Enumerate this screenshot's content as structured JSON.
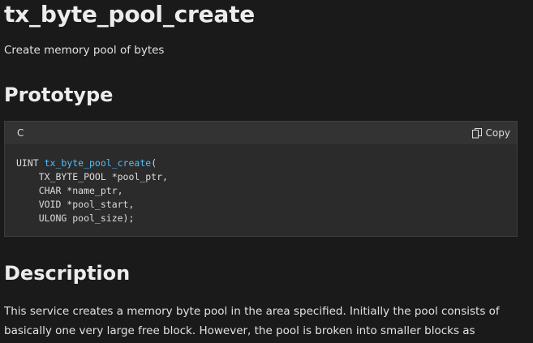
{
  "page": {
    "title": "tx_byte_pool_create",
    "subtitle": "Create memory pool of bytes"
  },
  "prototype": {
    "heading": "Prototype",
    "language": "C",
    "copy_label": "Copy",
    "copy_icon": "copy-icon",
    "code": {
      "return_type": "UINT ",
      "function_name": "tx_byte_pool_create",
      "open_paren": "(",
      "params": [
        "    TX_BYTE_POOL *pool_ptr,",
        "    CHAR *name_ptr,",
        "    VOID *pool_start,",
        "    ULONG pool_size);"
      ]
    },
    "colors": {
      "function_name": "#4fc1ff"
    }
  },
  "description": {
    "heading": "Description",
    "text": "This service creates a memory byte pool in the area specified. Initially the pool consists of basically one very large free block. However, the pool is broken into smaller blocks as allocations are made."
  }
}
